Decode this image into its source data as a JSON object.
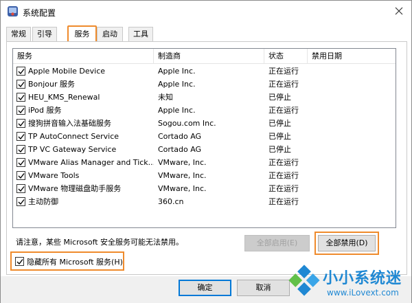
{
  "window": {
    "title": "系统配置"
  },
  "tabs": [
    {
      "label": "常规"
    },
    {
      "label": "引导"
    },
    {
      "label": "服务"
    },
    {
      "label": "启动"
    },
    {
      "label": "工具"
    }
  ],
  "columns": [
    "服务",
    "制造商",
    "状态",
    "禁用日期"
  ],
  "services": [
    {
      "name": "Apple Mobile Device",
      "maker": "Apple Inc.",
      "status": "正在运行",
      "checked": true
    },
    {
      "name": "Bonjour 服务",
      "maker": "Apple Inc.",
      "status": "正在运行",
      "checked": true
    },
    {
      "name": "HEU_KMS_Renewal",
      "maker": "未知",
      "status": "已停止",
      "checked": true
    },
    {
      "name": "iPod 服务",
      "maker": "Apple Inc.",
      "status": "正在运行",
      "checked": true
    },
    {
      "name": "搜狗拼音输入法基础服务",
      "maker": "Sogou.com Inc.",
      "status": "已停止",
      "checked": true
    },
    {
      "name": "TP AutoConnect Service",
      "maker": "Cortado AG",
      "status": "已停止",
      "checked": true
    },
    {
      "name": "TP VC Gateway Service",
      "maker": "Cortado AG",
      "status": "已停止",
      "checked": true
    },
    {
      "name": "VMware Alias Manager and Tick...",
      "maker": "VMware, Inc.",
      "status": "正在运行",
      "checked": true
    },
    {
      "name": "VMware Tools",
      "maker": "VMware, Inc.",
      "status": "正在运行",
      "checked": true
    },
    {
      "name": "VMware 物理磁盘助手服务",
      "maker": "VMware, Inc.",
      "status": "正在运行",
      "checked": true
    },
    {
      "name": "主动防御",
      "maker": "360.cn",
      "status": "正在运行",
      "checked": true
    }
  ],
  "notice": "请注意，某些 Microsoft 安全服务可能无法禁用。",
  "buttons": {
    "enable_all": "全部启用(E)",
    "disable_all": "全部禁用(D)",
    "ok": "确定",
    "cancel": "取消"
  },
  "hide_ms": {
    "label": "隐藏所有 Microsoft 服务(H)",
    "checked": true
  },
  "watermark": {
    "title": "小小系统迷",
    "url": "www.iLovext.com"
  },
  "colors": {
    "highlight": "#ef8a2b",
    "accent": "#0078d7",
    "watermark": "#1f88d3"
  }
}
